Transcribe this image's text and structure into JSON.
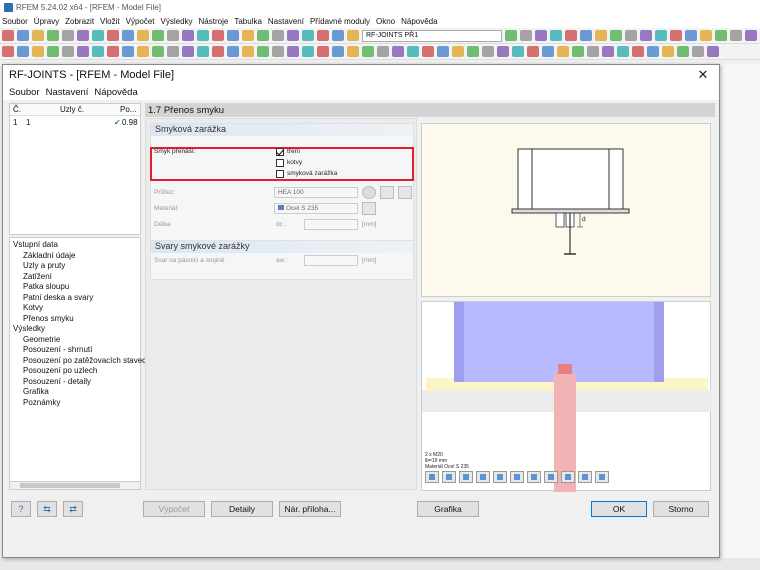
{
  "app": {
    "title": "RFEM 5.24.02 x64 - [RFEM - Model File]",
    "menu": [
      "Soubor",
      "Úpravy",
      "Zobrazit",
      "Vložit",
      "Výpočet",
      "Výsledky",
      "Nástroje",
      "Tabulka",
      "Nastavení",
      "Přídavné moduly",
      "Okno",
      "Nápověda"
    ],
    "case_combo": "RF-JOINTS PŘ1"
  },
  "dialog": {
    "title": "RF-JOINTS - [RFEM - Model File]",
    "menu": [
      "Soubor",
      "Nastavení",
      "Nápověda"
    ]
  },
  "table": {
    "headers": [
      "Č.",
      "Uzly č.",
      "Po..."
    ],
    "rows": [
      {
        "no": "1",
        "nodes": "1",
        "value": "0.98"
      }
    ]
  },
  "tree": {
    "section1": "Vstupní data",
    "items1": [
      "Základní údaje",
      "Uzly a pruty",
      "Zatížení",
      "Patka sloupu",
      "Patní deska a svary",
      "Kotvy",
      "Přenos smyku"
    ],
    "section2": "Výsledky",
    "items2": [
      "Geometrie",
      "Posouzení - shrnutí",
      "Posouzení po zatěžovacích stavech",
      "Posouzení po uzlech",
      "Posouzení - detaily",
      "Grafika",
      "Poznámky"
    ]
  },
  "panel": {
    "title": "1.7 Přenos smyku",
    "group1": "Smyková zarážka",
    "shear_label": "Smyk přenáší:",
    "options": [
      {
        "label": "tření",
        "checked": true
      },
      {
        "label": "kotvy",
        "checked": false
      },
      {
        "label": "smyková zarážka",
        "checked": false
      }
    ],
    "profile_label": "Průřez:",
    "profile_value": "HEA 100",
    "material_label": "Materiál:",
    "material_value": "Ocel S 235",
    "length_label": "Délka",
    "length_symbol": "dc :",
    "unit": "[mm]",
    "group2": "Svary smykové zarážky",
    "weld_label": "Svar na pásnici a stojině",
    "weld_symbol": "aw :",
    "weld_unit": "[mm]"
  },
  "graphic": {
    "dim_label": "d",
    "legend": [
      "2 x M20",
      "lb=19 mm",
      "Materiál Ocel S 235"
    ]
  },
  "buttons": {
    "calc": "Výpočet",
    "details": "Detaily",
    "nat_annex": "Nár. příloha...",
    "graphics": "Grafika",
    "ok": "OK",
    "cancel": "Storno"
  },
  "colors": {
    "highlight": "#e21f26",
    "accent": "#0078d7"
  }
}
